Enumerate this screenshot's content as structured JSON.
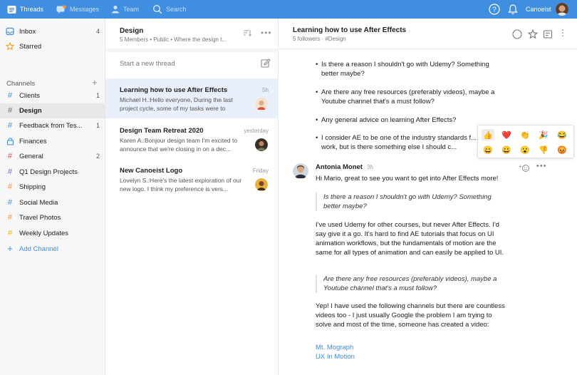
{
  "topbar": {
    "threads_label": "Threads",
    "messages_label": "Messages",
    "team_label": "Team",
    "search_label": "Search",
    "user_name": "Canoeist",
    "bg_color": "#3f8ee0"
  },
  "sidebar": {
    "inbox": {
      "label": "Inbox",
      "count": "4"
    },
    "starred": {
      "label": "Starred"
    },
    "channels_heading": "Channels",
    "channels": [
      {
        "label": "Clients",
        "count": "1",
        "color": "#3f8ee0"
      },
      {
        "label": "Design",
        "count": "",
        "color": "#888888"
      },
      {
        "label": "Feedback from Tes...",
        "count": "1",
        "color": "#3f8ee0"
      },
      {
        "label": "Finances",
        "count": "",
        "color": "#3f8ee0"
      },
      {
        "label": "General",
        "count": "2",
        "color": "#e0524f"
      },
      {
        "label": "Q1 Design Projects",
        "count": "",
        "color": "#8a5bd6"
      },
      {
        "label": "Shipping",
        "count": "",
        "color": "#ff8c3a"
      },
      {
        "label": "Social Media",
        "count": "",
        "color": "#3f8ee0"
      },
      {
        "label": "Travel Photos",
        "count": "",
        "color": "#ff8c3a"
      },
      {
        "label": "Weekly Updates",
        "count": "",
        "color": "#f4b400"
      }
    ],
    "add_channel": "Add Channel"
  },
  "threadlist": {
    "title": "Design",
    "subtitle": "5 Members • Public • Where the design t...",
    "new_thread_placeholder": "Start a new thread",
    "threads": [
      {
        "title": "Learning how to use After Effects",
        "time": "5h",
        "snippet": "Michael H.:Hello everyone, During the last project cycle, some of my tasks were to"
      },
      {
        "title": "Design Team Retreat 2020",
        "time": "yesterday",
        "snippet": "Karen A.:Bonjour design team I'm excited to announce that we're closing in on a dec..."
      },
      {
        "title": "New Canoeist Logo",
        "time": "Friday",
        "snippet": "Lovelyn S.:Here's the latest exploration of our new logo. I think my preference is vers..."
      }
    ]
  },
  "thread": {
    "title": "Learning how to use After Effects",
    "followers": "5 followers",
    "channel_tag": "#Design",
    "bullets": [
      "Is there a reason I shouldn't go with Udemy? Something better maybe?",
      "Are there any free resources (preferably videos), maybe a Youtube channel that's a must follow?",
      "Any general advice on learning After Effects?",
      "I consider AE to be one of the industry standards f... kind of work, but is there something else I should c..."
    ],
    "reply": {
      "author": "Antonia Monet",
      "time": "3h",
      "greeting": "Hi Mario, great to see you want to get into After Effects more!",
      "quote1": "Is there a reason I shouldn't go with Udemy? Something better maybe?",
      "para1": "I've used Udemy for other courses, but never After Effects. I'd say give it a go. It's hard to find AE tutorials that focus on UI animation workflows, but the fundamentals of motion are the same for all types of animation and can easily be applied to UI.",
      "quote2": "Are there any free resources (preferably videos), maybe a Youtube channel that's a must follow?",
      "para2": "Yep! I have used the following channels but there are countless videos too - I just usually Google the problem I am trying to solve and most of the time, someone has created a video:",
      "links": [
        "Mt. Mograph",
        "UX In Motion"
      ]
    }
  },
  "reactions": [
    "👍",
    "❤️",
    "👏",
    "🎉",
    "😂",
    "😄",
    "😀",
    "😮",
    "👎",
    "😡"
  ]
}
